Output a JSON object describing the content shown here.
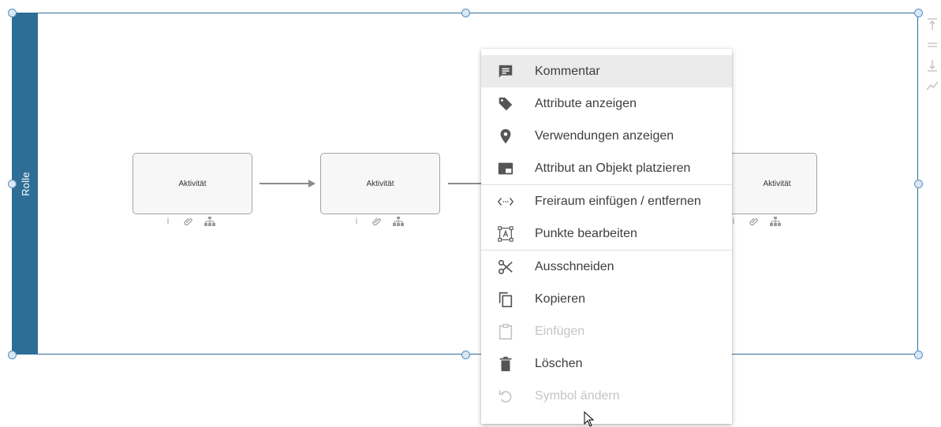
{
  "lane": {
    "label": "Rolle"
  },
  "activities": [
    {
      "label": "Aktivität"
    },
    {
      "label": "Aktivität"
    },
    {
      "label": "Aktivität"
    }
  ],
  "context_menu": {
    "items": [
      {
        "label": "Kommentar",
        "icon": "comment-icon",
        "state": "hovered"
      },
      {
        "label": "Attribute anzeigen",
        "icon": "tag-icon",
        "state": "enabled"
      },
      {
        "label": "Verwendungen anzeigen",
        "icon": "location-pin-icon",
        "state": "enabled"
      },
      {
        "label": "Attribut an Objekt platzieren",
        "icon": "place-attribute-icon",
        "state": "enabled"
      },
      {
        "label": "Freiraum einfügen / entfernen",
        "icon": "free-space-icon",
        "state": "enabled"
      },
      {
        "label": "Punkte bearbeiten",
        "icon": "edit-points-icon",
        "state": "enabled"
      },
      {
        "label": "Ausschneiden",
        "icon": "scissors-icon",
        "state": "enabled"
      },
      {
        "label": "Kopieren",
        "icon": "copy-icon",
        "state": "enabled"
      },
      {
        "label": "Einfügen",
        "icon": "clipboard-icon",
        "state": "disabled"
      },
      {
        "label": "Löschen",
        "icon": "trash-icon",
        "state": "enabled"
      },
      {
        "label": "Symbol ändern",
        "icon": "undo-icon",
        "state": "disabled"
      }
    ]
  },
  "colors": {
    "lane_header": "#2e6e96",
    "menu_icon": "#555555",
    "disabled": "#c4c4c4",
    "hover_bg": "#ebebeb"
  }
}
